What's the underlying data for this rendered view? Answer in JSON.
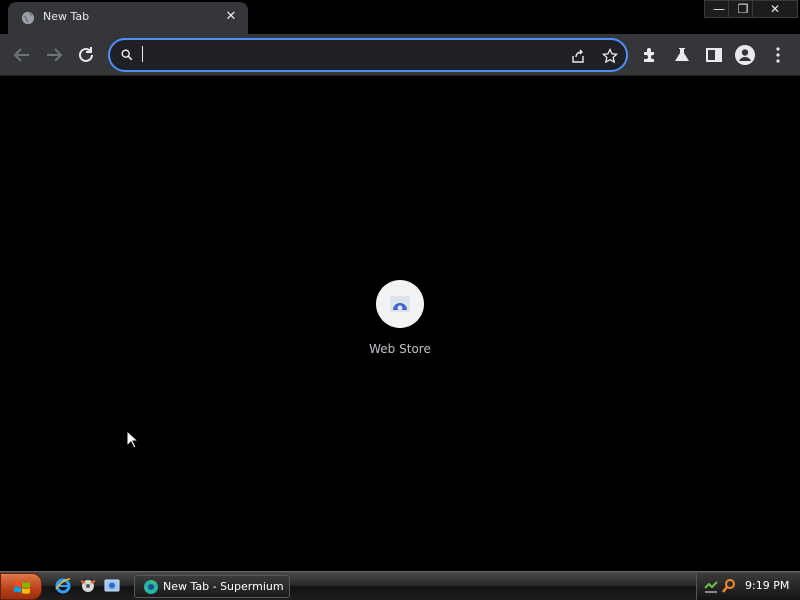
{
  "window": {
    "minimize_glyph": "—",
    "maximize_glyph": "❐",
    "close_glyph": "✕"
  },
  "tab": {
    "title": "New Tab",
    "close_glyph": "✕",
    "favicon": "globe-icon"
  },
  "toolbar": {
    "back_icon": "arrow-left-icon",
    "forward_icon": "arrow-right-icon",
    "reload_icon": "reload-icon",
    "omnibox": {
      "value": "",
      "placeholder": "",
      "accent_color": "#4f8ff7"
    },
    "share_icon": "share-icon",
    "bookmark_icon": "star-icon",
    "extensions_icon": "puzzle-icon",
    "labs_icon": "flask-icon",
    "side_panel_icon": "side-panel-icon",
    "profile_icon": "avatar-icon",
    "menu_icon": "kebab-menu-icon"
  },
  "content": {
    "background": "#000000",
    "shortcuts": [
      {
        "label": "Web Store",
        "icon": "web-store-icon"
      }
    ]
  },
  "taskbar": {
    "start_icon": "windows-logo-icon",
    "quick_launch": [
      "internet-explorer-icon",
      "media-icon",
      "desktop-icon"
    ],
    "tasks": [
      {
        "label": "New Tab - Supermium",
        "icon": "supermium-icon"
      }
    ],
    "tray_icons": [
      "network-icon",
      "search-icon"
    ],
    "clock": "9:19 PM"
  }
}
